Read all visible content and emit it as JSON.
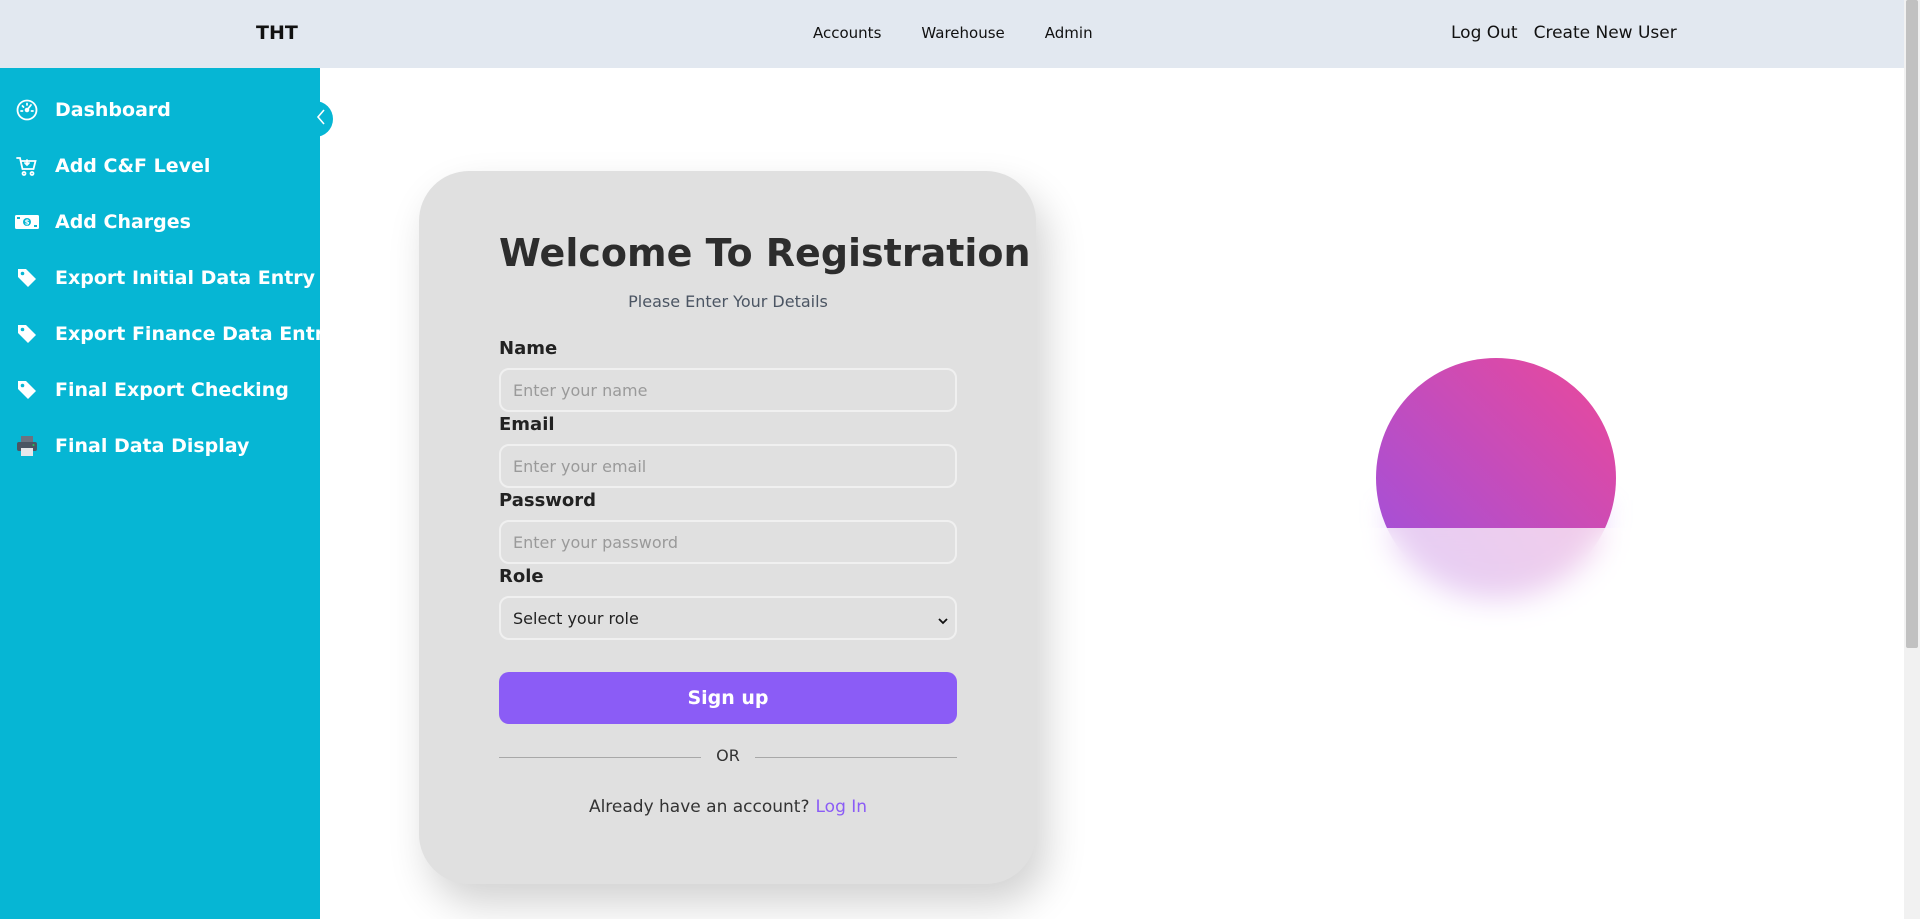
{
  "header": {
    "brand": "THT",
    "nav": [
      {
        "label": "Accounts"
      },
      {
        "label": "Warehouse"
      },
      {
        "label": "Admin"
      }
    ],
    "logout_label": "Log Out",
    "create_user_label": "Create New User"
  },
  "sidebar": {
    "items": [
      {
        "label": "Dashboard",
        "icon": "dashboard-icon"
      },
      {
        "label": "Add C&F Level",
        "icon": "cart-icon"
      },
      {
        "label": "Add Charges",
        "icon": "money-icon"
      },
      {
        "label": "Export Initial Data Entry",
        "icon": "tag-icon"
      },
      {
        "label": "Export Finance Data Entry",
        "icon": "tag-icon"
      },
      {
        "label": "Final Export Checking",
        "icon": "tag-icon"
      },
      {
        "label": "Final Data Display",
        "icon": "printer-icon"
      }
    ],
    "collapse_icon": "chevron-left-icon"
  },
  "form": {
    "title": "Welcome To Registration",
    "subtitle": "Please Enter Your Details",
    "name_label": "Name",
    "name_placeholder": "Enter your name",
    "email_label": "Email",
    "email_placeholder": "Enter your email",
    "password_label": "Password",
    "password_placeholder": "Enter your password",
    "role_label": "Role",
    "role_selected": "Select your role",
    "signup_label": "Sign up",
    "or_text": "OR",
    "account_prompt": "Already have an account?",
    "login_link": "Log In"
  },
  "colors": {
    "sidebar": "#06b6d4",
    "topbar": "#e2e8f0",
    "primary": "#8b5cf6",
    "card": "#e0e0e0"
  }
}
